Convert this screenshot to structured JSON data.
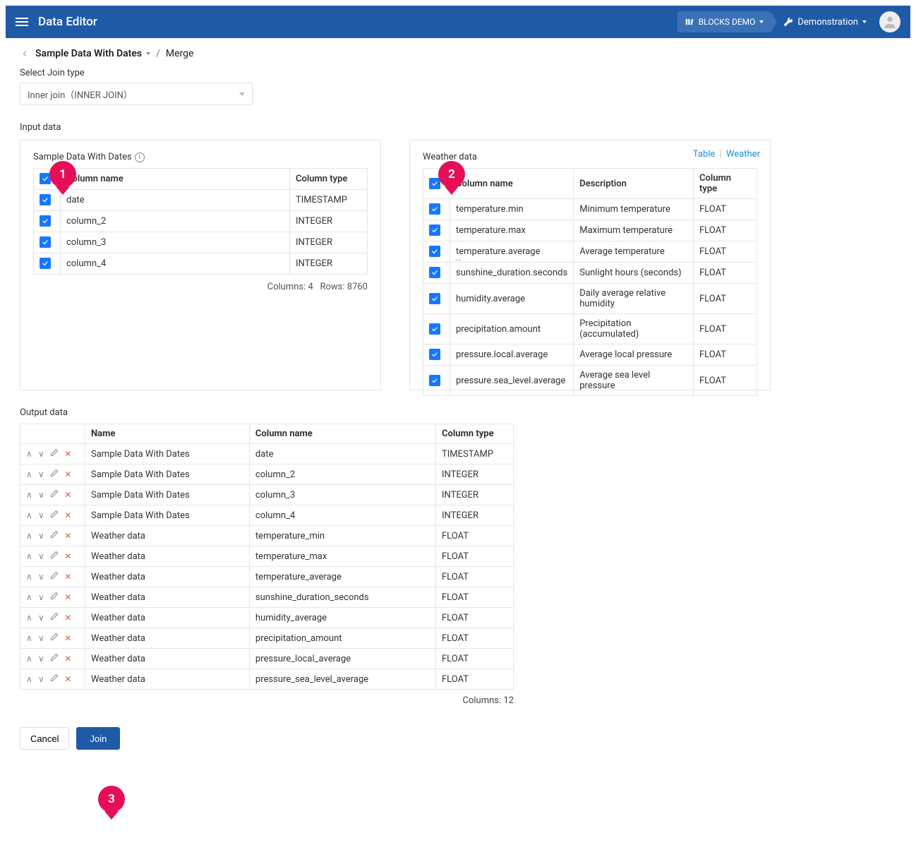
{
  "header": {
    "title": "Data Editor",
    "blocks_demo": "BLOCKS DEMO",
    "demonstration": "Demonstration"
  },
  "breadcrumb": {
    "title": "Sample Data With Dates",
    "current": "Merge"
  },
  "join": {
    "label": "Select Join type",
    "value": "Inner join（INNER JOIN）"
  },
  "input_label": "Input data",
  "panel1": {
    "title": "Sample Data With Dates",
    "headers": {
      "name": "Column name",
      "type": "Column type"
    },
    "rows": [
      {
        "name": "date",
        "type": "TIMESTAMP"
      },
      {
        "name": "column_2",
        "type": "INTEGER"
      },
      {
        "name": "column_3",
        "type": "INTEGER"
      },
      {
        "name": "column_4",
        "type": "INTEGER"
      }
    ],
    "footer": {
      "cols": "Columns: 4",
      "rows": "Rows: 8760"
    }
  },
  "panel2": {
    "title": "Weather data",
    "links": {
      "table": "Table",
      "weather": "Weather"
    },
    "headers": {
      "name": "Column name",
      "desc": "Description",
      "type": "Column type"
    },
    "rows": [
      {
        "name": "temperature.min",
        "desc": "Minimum temperature",
        "type": "FLOAT"
      },
      {
        "name": "temperature.max",
        "desc": "Maximum temperature",
        "type": "FLOAT"
      },
      {
        "name": "temperature.average",
        "desc": "Average temperature",
        "type": "FLOAT"
      },
      {
        "name": "sunshine_duration.seconds",
        "desc": "Sunlight hours (seconds)",
        "type": "FLOAT"
      },
      {
        "name": "humidity.average",
        "desc": "Daily average relative humidity",
        "type": "FLOAT"
      },
      {
        "name": "precipitation.amount",
        "desc": "Precipitation (accumulated)",
        "type": "FLOAT"
      },
      {
        "name": "pressure.local.average",
        "desc": "Average local pressure",
        "type": "FLOAT"
      },
      {
        "name": "pressure.sea_level.average",
        "desc": "Average sea level pressure",
        "type": "FLOAT"
      }
    ]
  },
  "output": {
    "label": "Output data",
    "headers": {
      "name": "Name",
      "col": "Column name",
      "type": "Column type"
    },
    "rows": [
      {
        "src": "Sample Data With Dates",
        "col": "date",
        "type": "TIMESTAMP"
      },
      {
        "src": "Sample Data With Dates",
        "col": "column_2",
        "type": "INTEGER"
      },
      {
        "src": "Sample Data With Dates",
        "col": "column_3",
        "type": "INTEGER"
      },
      {
        "src": "Sample Data With Dates",
        "col": "column_4",
        "type": "INTEGER"
      },
      {
        "src": "Weather data",
        "col": "temperature_min",
        "type": "FLOAT"
      },
      {
        "src": "Weather data",
        "col": "temperature_max",
        "type": "FLOAT"
      },
      {
        "src": "Weather data",
        "col": "temperature_average",
        "type": "FLOAT"
      },
      {
        "src": "Weather data",
        "col": "sunshine_duration_seconds",
        "type": "FLOAT"
      },
      {
        "src": "Weather data",
        "col": "humidity_average",
        "type": "FLOAT"
      },
      {
        "src": "Weather data",
        "col": "precipitation_amount",
        "type": "FLOAT"
      },
      {
        "src": "Weather data",
        "col": "pressure_local_average",
        "type": "FLOAT"
      },
      {
        "src": "Weather data",
        "col": "pressure_sea_level_average",
        "type": "FLOAT"
      }
    ],
    "footer": "Columns: 12"
  },
  "buttons": {
    "cancel": "Cancel",
    "join": "Join"
  },
  "badges": {
    "b1": "1",
    "b2": "2",
    "b3": "3"
  }
}
